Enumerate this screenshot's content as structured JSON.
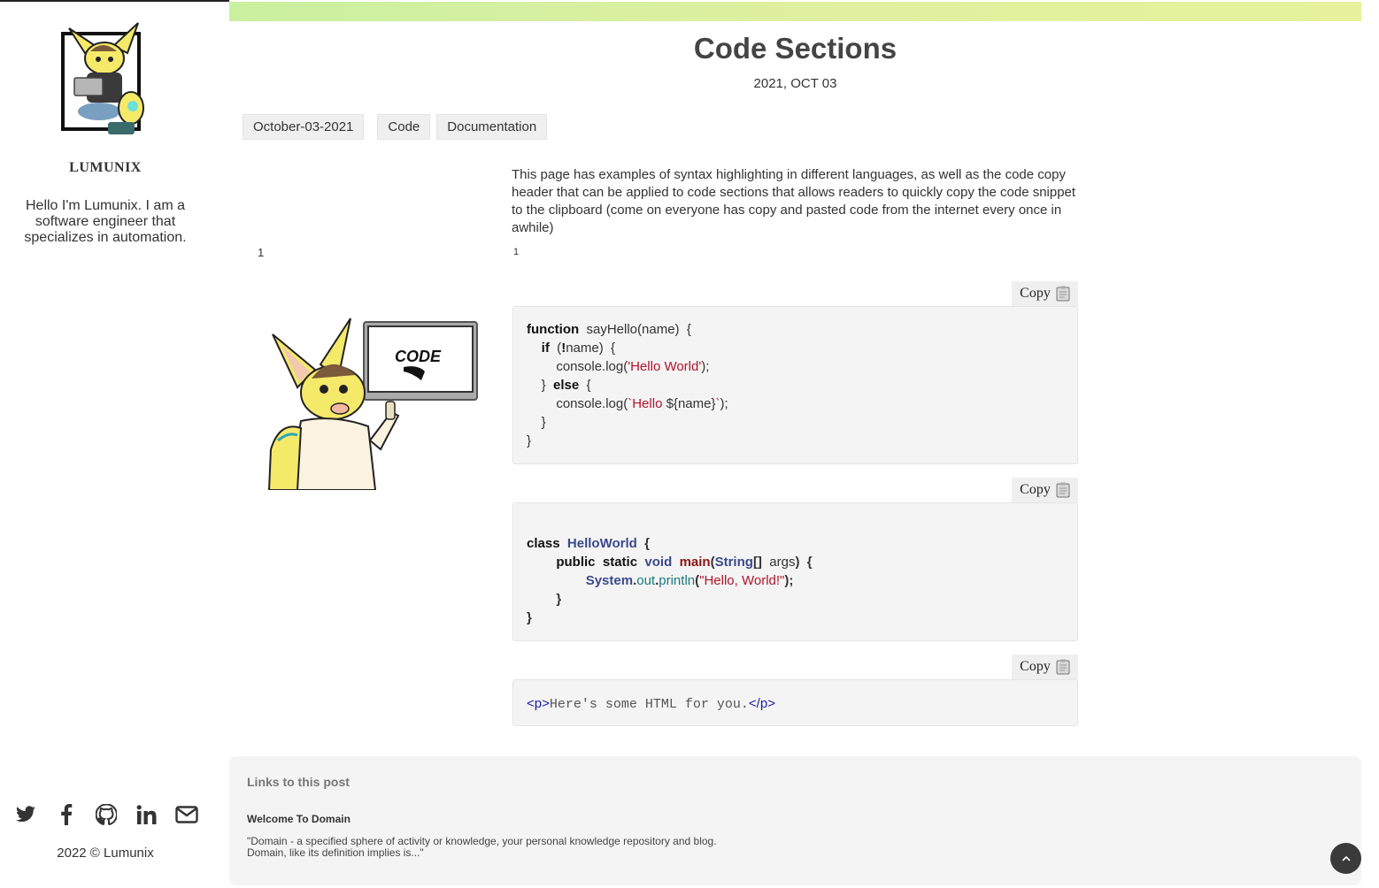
{
  "sidebar": {
    "site_name": "LUMUNIX",
    "bio": "Hello I'm Lumunix. I am a software engineer that specializes in automation.",
    "socials": [
      "twitter-icon",
      "facebook-icon",
      "github-icon",
      "linkedin-icon",
      "mail-icon"
    ],
    "copyright": "2022 © Lumunix"
  },
  "progress": {
    "fraction": 1.0,
    "color": "#dff0a0"
  },
  "post": {
    "title": "Code Sections",
    "date": "2021, OCT 03",
    "tags": [
      "October-03-2021",
      "Code",
      "Documentation"
    ],
    "intro": "This page has examples of syntax highlighting in different languages, as well as the code copy header that can be applied to code sections that allows readers to quickly copy the code snippet to the clipboard (come on everyone has copy and pasted code from the internet every once in awhile)",
    "footnote_left": "1",
    "footnote_right": "1",
    "mascot_sign": "CODE"
  },
  "code_blocks": [
    {
      "copy_label": "Copy",
      "language": "javascript",
      "lines": [
        "function  sayHello(name)  {",
        "    if  (!name)  {",
        "        console.log('Hello World');",
        "    }  else  {",
        "        console.log(`Hello ${name}`);",
        "    }",
        "}"
      ]
    },
    {
      "copy_label": "Copy",
      "language": "java",
      "lines": [
        "class  HelloWorld  {",
        "        public  static  void  main(String[]  args)  {",
        "                System.out.println(\"Hello, World!\");",
        "        }",
        "}"
      ]
    },
    {
      "copy_label": "Copy",
      "language": "html",
      "lines": [
        "<p>Here's some HTML for you.</p>"
      ]
    }
  ],
  "backlinks": {
    "heading": "Links to this post",
    "items": [
      {
        "title": "Welcome To Domain",
        "excerpt_line1": "\"Domain - a specified sphere of activity or knowledge, your personal knowledge repository and blog.",
        "excerpt_line2": "Domain, like its definition implies is...\""
      }
    ]
  },
  "scroll_top_icon": "chevron-up-icon"
}
